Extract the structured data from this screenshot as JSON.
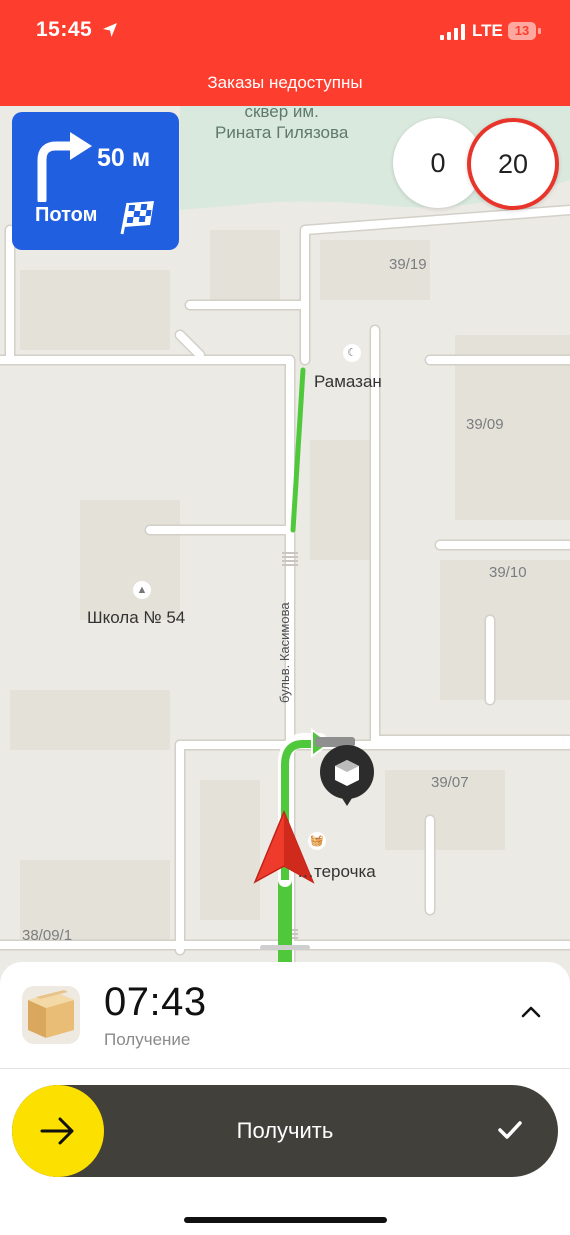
{
  "status_bar": {
    "time": "15:45",
    "network": "LTE",
    "battery": "13",
    "location_icon": "location-arrow-icon",
    "signal_icon": "signal-bars-icon"
  },
  "banner": {
    "text": "Заказы недоступны"
  },
  "navigation": {
    "distance": "50 м",
    "then_label": "Потом",
    "turn_icon": "turn-right-icon",
    "finish_icon": "finish-flag-icon",
    "accent_color": "#1f5fe0"
  },
  "speed": {
    "current": "0",
    "limit": "20"
  },
  "map": {
    "park_name": "сквер им.\nРината Гилязова",
    "park_line1": "сквер им.",
    "park_line2": "Рината Гилязова",
    "houses": [
      "39/19",
      "39/09",
      "39/10",
      "39/07",
      "38/09/1"
    ],
    "pois": {
      "mosque": "Рамазан",
      "school": "Школа № 54",
      "shop": "…терочка"
    },
    "street": "бульв. Касимова",
    "route_color": "#4fc83c"
  },
  "sheet": {
    "eta": "07:43",
    "eta_label": "Получение",
    "action_label": "Получить",
    "knob_color": "#fce000",
    "track_color": "#42403b"
  }
}
